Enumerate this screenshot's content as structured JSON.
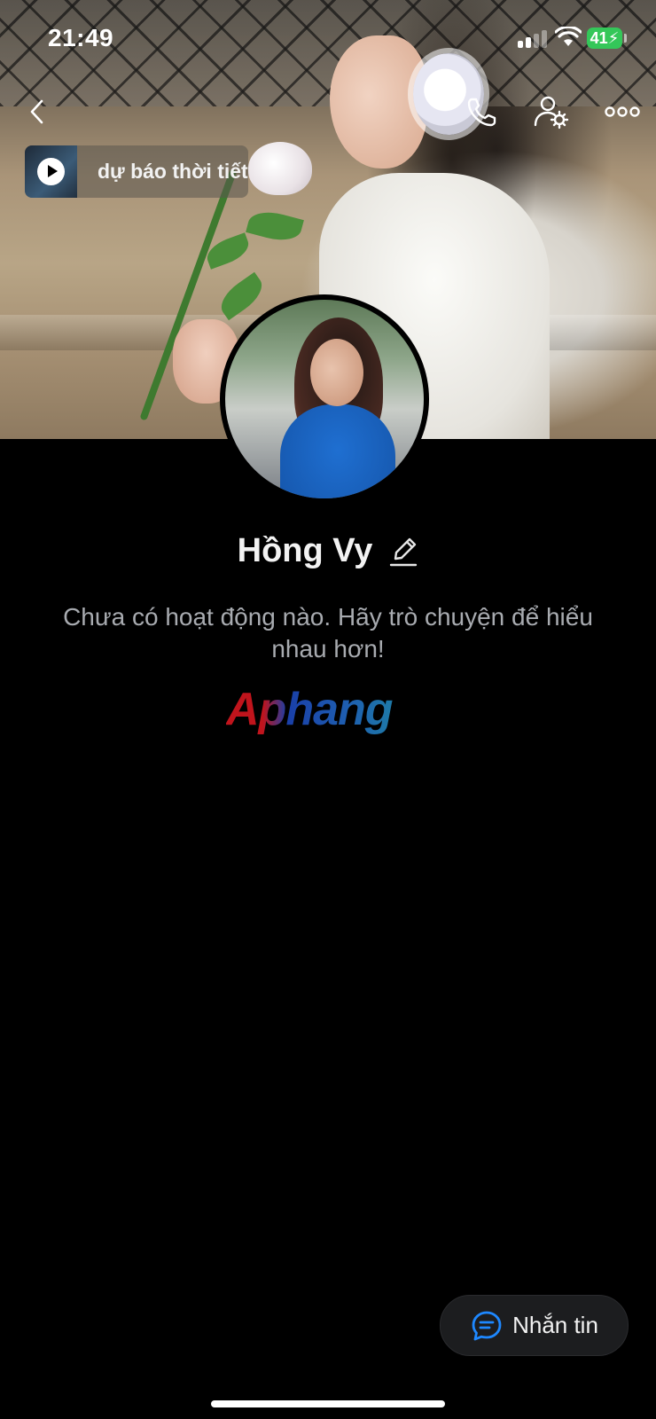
{
  "status_bar": {
    "time": "21:49",
    "battery": "41"
  },
  "header": {
    "back_icon": "chevron-left-icon",
    "call_icon": "phone-icon",
    "settings_icon": "user-gear-icon",
    "more_icon": "more-horizontal-icon"
  },
  "music": {
    "title": "dự báo thời tiết",
    "play_icon": "play-icon"
  },
  "profile": {
    "name": "Hồng Vy",
    "edit_icon": "pencil-icon",
    "bio": "Chưa có hoạt động nào. Hãy trò chuyện để hiểu nhau hơn!"
  },
  "watermark": "Aphang",
  "actions": {
    "message_label": "Nhắn tin",
    "message_icon": "chat-bubble-icon"
  },
  "colors": {
    "accent": "#1e88ff",
    "battery": "#34c759",
    "background": "#000000"
  }
}
